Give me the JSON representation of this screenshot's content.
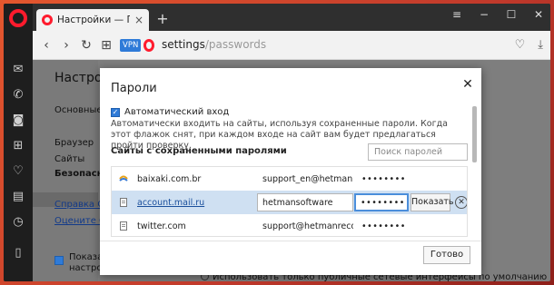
{
  "browser": {
    "tab_title": "Настройки — Пароли",
    "tab_close": "×",
    "new_tab": "+",
    "window_controls": {
      "menu": "≡",
      "minimize": "−",
      "maximize": "☐",
      "close": "✕"
    },
    "nav": {
      "back": "‹",
      "forward": "›",
      "reload": "↻",
      "speed_dial": "⊞"
    },
    "vpn_badge": "VPN",
    "url_host": "settings",
    "url_path": "/passwords",
    "addr_icons": {
      "heart": "♡",
      "download": "⤓"
    }
  },
  "opera_sidebar": {
    "icons": [
      "messenger-icon",
      "whatsapp-icon",
      "camera-icon",
      "speed-dial-icon",
      "heart-icon",
      "news-icon",
      "history-icon",
      "sidebar-toggle-icon"
    ]
  },
  "settings_page": {
    "title": "Настрой",
    "nav": {
      "basic": "Основные",
      "browser": "Браузер",
      "sites": "Сайты",
      "security": "Безопасност",
      "help_link": "Справка Оп",
      "rate_link": "Оцените Оп"
    },
    "bottom_checkbox_line1": "Показать",
    "bottom_checkbox_line2": "настройк",
    "bottom_hint": "Использовать только публичные сетевые интерфейсы по умолчанию"
  },
  "dialog": {
    "title": "Пароли",
    "close": "✕",
    "auto_login_label": "Автоматический вход",
    "auto_login_checked": true,
    "auto_login_description": "Автоматически входить на сайты, используя сохраненные пароли. Когда этот флажок снят, при каждом входе на сайт вам будет предлагаться пройти проверку.",
    "saved_header": "Сайты с сохраненными паролями",
    "search_placeholder": "Поиск паролей",
    "rows": [
      {
        "site": "baixaki.com.br",
        "user": "support_en@hetmanrecove",
        "password": "••••••••"
      },
      {
        "site": "account.mail.ru",
        "user": "hetmansoftware",
        "password": "••••••••",
        "show_label": "Показать",
        "delete": "✕"
      },
      {
        "site": "twitter.com",
        "user": "support@hetmanrecovery.",
        "password": "••••••••"
      }
    ],
    "done_label": "Готово"
  }
}
